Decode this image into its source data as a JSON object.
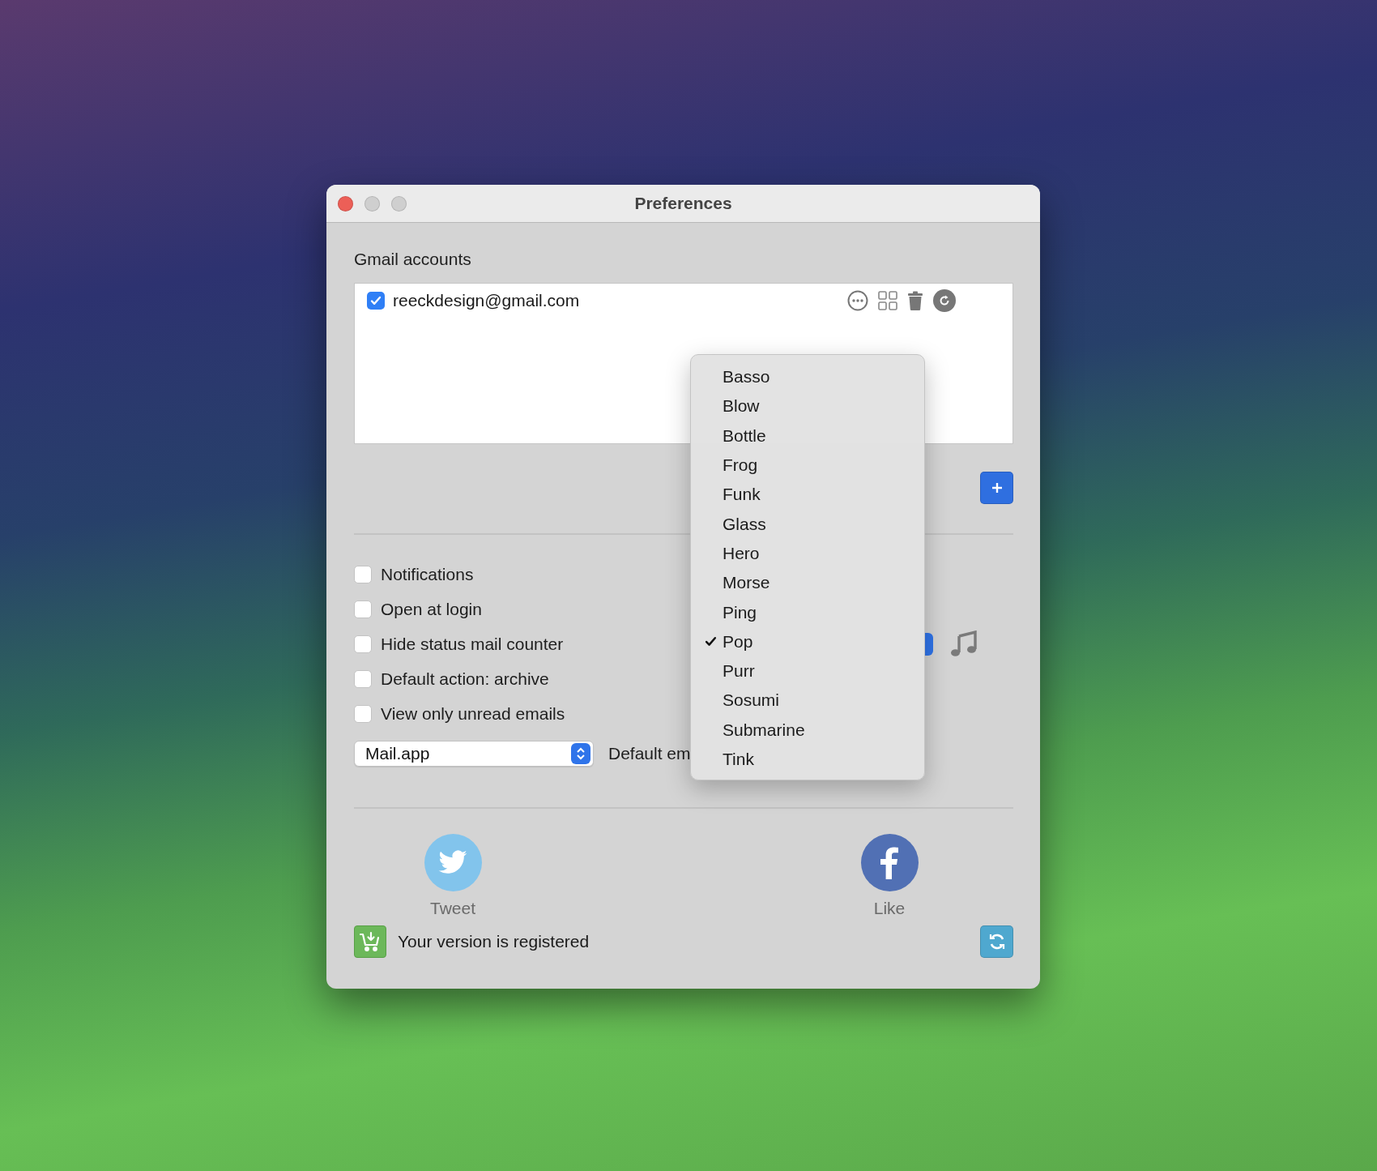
{
  "window": {
    "title": "Preferences"
  },
  "accounts": {
    "label": "Gmail accounts",
    "items": [
      {
        "email": "reeckdesign@gmail.com",
        "checked": true
      }
    ]
  },
  "options": [
    {
      "label": "Notifications",
      "checked": false
    },
    {
      "label": "Open at login",
      "checked": false
    },
    {
      "label": "Hide status mail counter",
      "checked": false
    },
    {
      "label": "Default action: archive",
      "checked": false
    },
    {
      "label": "View only unread emails",
      "checked": false
    }
  ],
  "email_client": {
    "value": "Mail.app",
    "label": "Default em"
  },
  "sound_menu": {
    "items": [
      {
        "label": "Basso",
        "selected": false
      },
      {
        "label": "Blow",
        "selected": false
      },
      {
        "label": "Bottle",
        "selected": false
      },
      {
        "label": "Frog",
        "selected": false
      },
      {
        "label": "Funk",
        "selected": false
      },
      {
        "label": "Glass",
        "selected": false
      },
      {
        "label": "Hero",
        "selected": false
      },
      {
        "label": "Morse",
        "selected": false
      },
      {
        "label": "Ping",
        "selected": false
      },
      {
        "label": "Pop",
        "selected": true
      },
      {
        "label": "Purr",
        "selected": false
      },
      {
        "label": "Sosumi",
        "selected": false
      },
      {
        "label": "Submarine",
        "selected": false
      },
      {
        "label": "Tink",
        "selected": false
      }
    ]
  },
  "social": [
    {
      "kind": "twitter",
      "label": "Tweet"
    },
    {
      "kind": "facebook",
      "label": "Like"
    }
  ],
  "status": {
    "text": "Your version is registered"
  }
}
